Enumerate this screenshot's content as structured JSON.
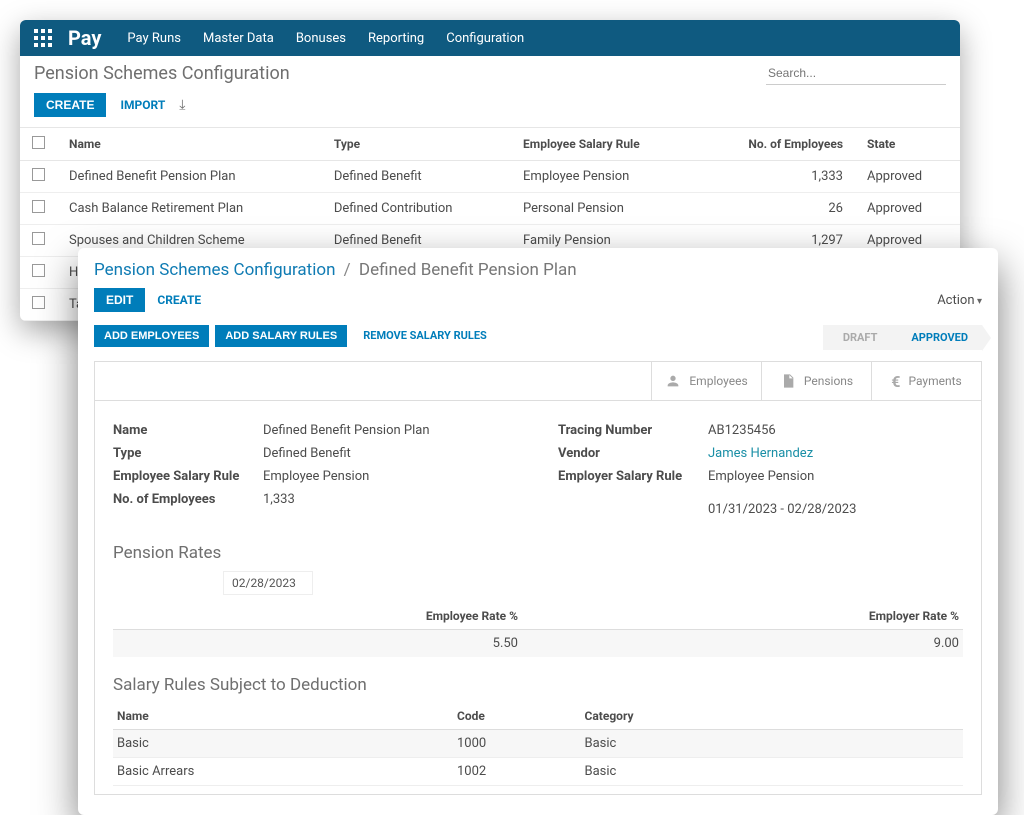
{
  "header": {
    "app_title": "Pay",
    "nav": [
      "Pay Runs",
      "Master Data",
      "Bonuses",
      "Reporting",
      "Configuration"
    ]
  },
  "list_page": {
    "title": "Pension Schemes Configuration",
    "search_placeholder": "Search...",
    "create": "CREATE",
    "import": "IMPORT",
    "columns": {
      "name": "Name",
      "type": "Type",
      "rule": "Employee Salary Rule",
      "emp": "No. of Employees",
      "state": "State"
    },
    "rows": [
      {
        "name": "Defined Benefit Pension Plan",
        "type": "Defined Benefit",
        "rule": "Employee Pension",
        "emp": "1,333",
        "state": "Approved"
      },
      {
        "name": "Cash Balance Retirement Plan",
        "type": "Defined Contribution",
        "rule": "Personal Pension",
        "emp": "26",
        "state": "Approved"
      },
      {
        "name": "Spouses and Children Scheme",
        "type": "Defined Benefit",
        "rule": "Family Pension",
        "emp": "1,297",
        "state": "Approved"
      },
      {
        "name": "Hyb",
        "type": "",
        "rule": "",
        "emp": "",
        "state": ""
      },
      {
        "name": "Tar",
        "type": "",
        "rule": "",
        "emp": "",
        "state": ""
      }
    ]
  },
  "detail_page": {
    "breadcrumb_root": "Pension Schemes Configuration",
    "breadcrumb_current": "Defined Benefit Pension Plan",
    "edit": "EDIT",
    "create": "CREATE",
    "action": "Action",
    "add_emp": "ADD EMPLOYEES",
    "add_rules": "ADD SALARY RULES",
    "remove_rules": "REMOVE SALARY RULES",
    "status": {
      "draft": "DRAFT",
      "approved": "APPROVED"
    },
    "tabs": {
      "employees": "Employees",
      "pensions": "Pensions",
      "payments": "Payments"
    },
    "left": {
      "name_l": "Name",
      "name_v": "Defined Benefit Pension Plan",
      "type_l": "Type",
      "type_v": "Defined Benefit",
      "rule_l": "Employee Salary Rule",
      "rule_v": "Employee Pension",
      "emp_l": "No. of Employees",
      "emp_v": "1,333"
    },
    "right": {
      "trace_l": "Tracing Number",
      "trace_v": "AB1235456",
      "vendor_l": "Vendor",
      "vendor_v": "James Hernandez",
      "erule_l": "Employer Salary Rule",
      "erule_v": "Employee Pension",
      "period": "01/31/2023 - 02/28/2023"
    },
    "rates": {
      "title": "Pension Rates",
      "date": "02/28/2023",
      "emp_head": "Employee Rate %",
      "employer_head": "Employer Rate %",
      "emp_rate": "5.50",
      "employer_rate": "9.00"
    },
    "rules": {
      "title": "Salary Rules Subject to Deduction",
      "cols": {
        "name": "Name",
        "code": "Code",
        "cat": "Category"
      },
      "rows": [
        {
          "name": "Basic",
          "code": "1000",
          "cat": "Basic"
        },
        {
          "name": "Basic Arrears",
          "code": "1002",
          "cat": "Basic"
        }
      ]
    }
  }
}
